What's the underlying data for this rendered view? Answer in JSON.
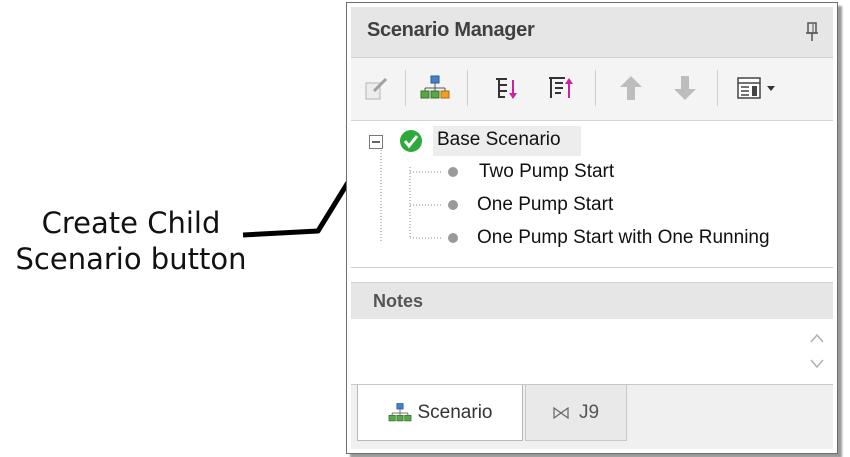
{
  "callout": {
    "line1": "Create Child",
    "line2": "Scenario button"
  },
  "panel": {
    "title": "Scenario Manager",
    "pin_icon": "pin-icon"
  },
  "toolbar": {
    "buttons": [
      {
        "icon": "edit-scenario-icon"
      },
      {
        "icon": "create-child-scenario-icon"
      },
      {
        "icon": "sort-down-icon"
      },
      {
        "icon": "sort-up-icon"
      },
      {
        "icon": "move-up-arrow-icon"
      },
      {
        "icon": "move-down-arrow-icon"
      },
      {
        "icon": "view-options-icon"
      }
    ]
  },
  "tree": {
    "root": {
      "label": "Base Scenario",
      "icon": "checkmark-icon",
      "status_color": "#2eaa3c"
    },
    "children": [
      {
        "label": "Two Pump Start"
      },
      {
        "label": "One Pump Start"
      },
      {
        "label": "One Pump Start with One Running"
      }
    ]
  },
  "notes": {
    "header": "Notes",
    "value": ""
  },
  "tabs": [
    {
      "label": "Scenario",
      "icon": "scenario-tree-icon",
      "active": true
    },
    {
      "label": "J9",
      "icon": "valve-icon",
      "active": false
    }
  ]
}
